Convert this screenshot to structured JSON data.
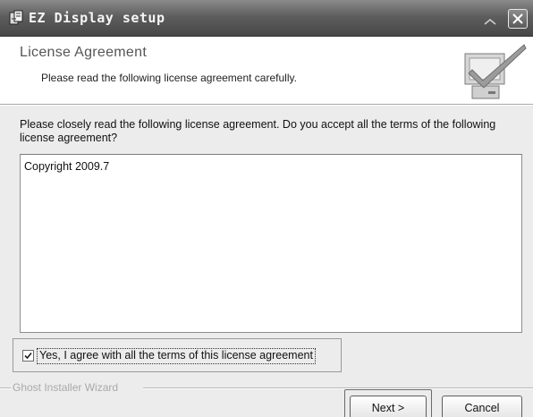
{
  "window": {
    "title": "EZ Display setup",
    "icons": {
      "app": "setup-icon",
      "minimize": "minimize-icon",
      "close": "close-icon"
    }
  },
  "header": {
    "title": "License Agreement",
    "subtitle": "Please read the following license agreement carefully.",
    "graphic": "computer-checkmark-icon"
  },
  "body": {
    "prompt": "Please closely read the following license agreement. Do you accept all the terms of the following license agreement?",
    "license_text": "Copyright 2009.7"
  },
  "agreement": {
    "label": "Yes, I agree with all the terms of this license agreement",
    "checked": true
  },
  "footer": {
    "branding": "Ghost Installer Wizard",
    "next_label": "Next >",
    "cancel_label": "Cancel"
  },
  "colors": {
    "titlebar": "#5e5e5e",
    "background": "#ececec",
    "header_background": "#ffffff"
  }
}
